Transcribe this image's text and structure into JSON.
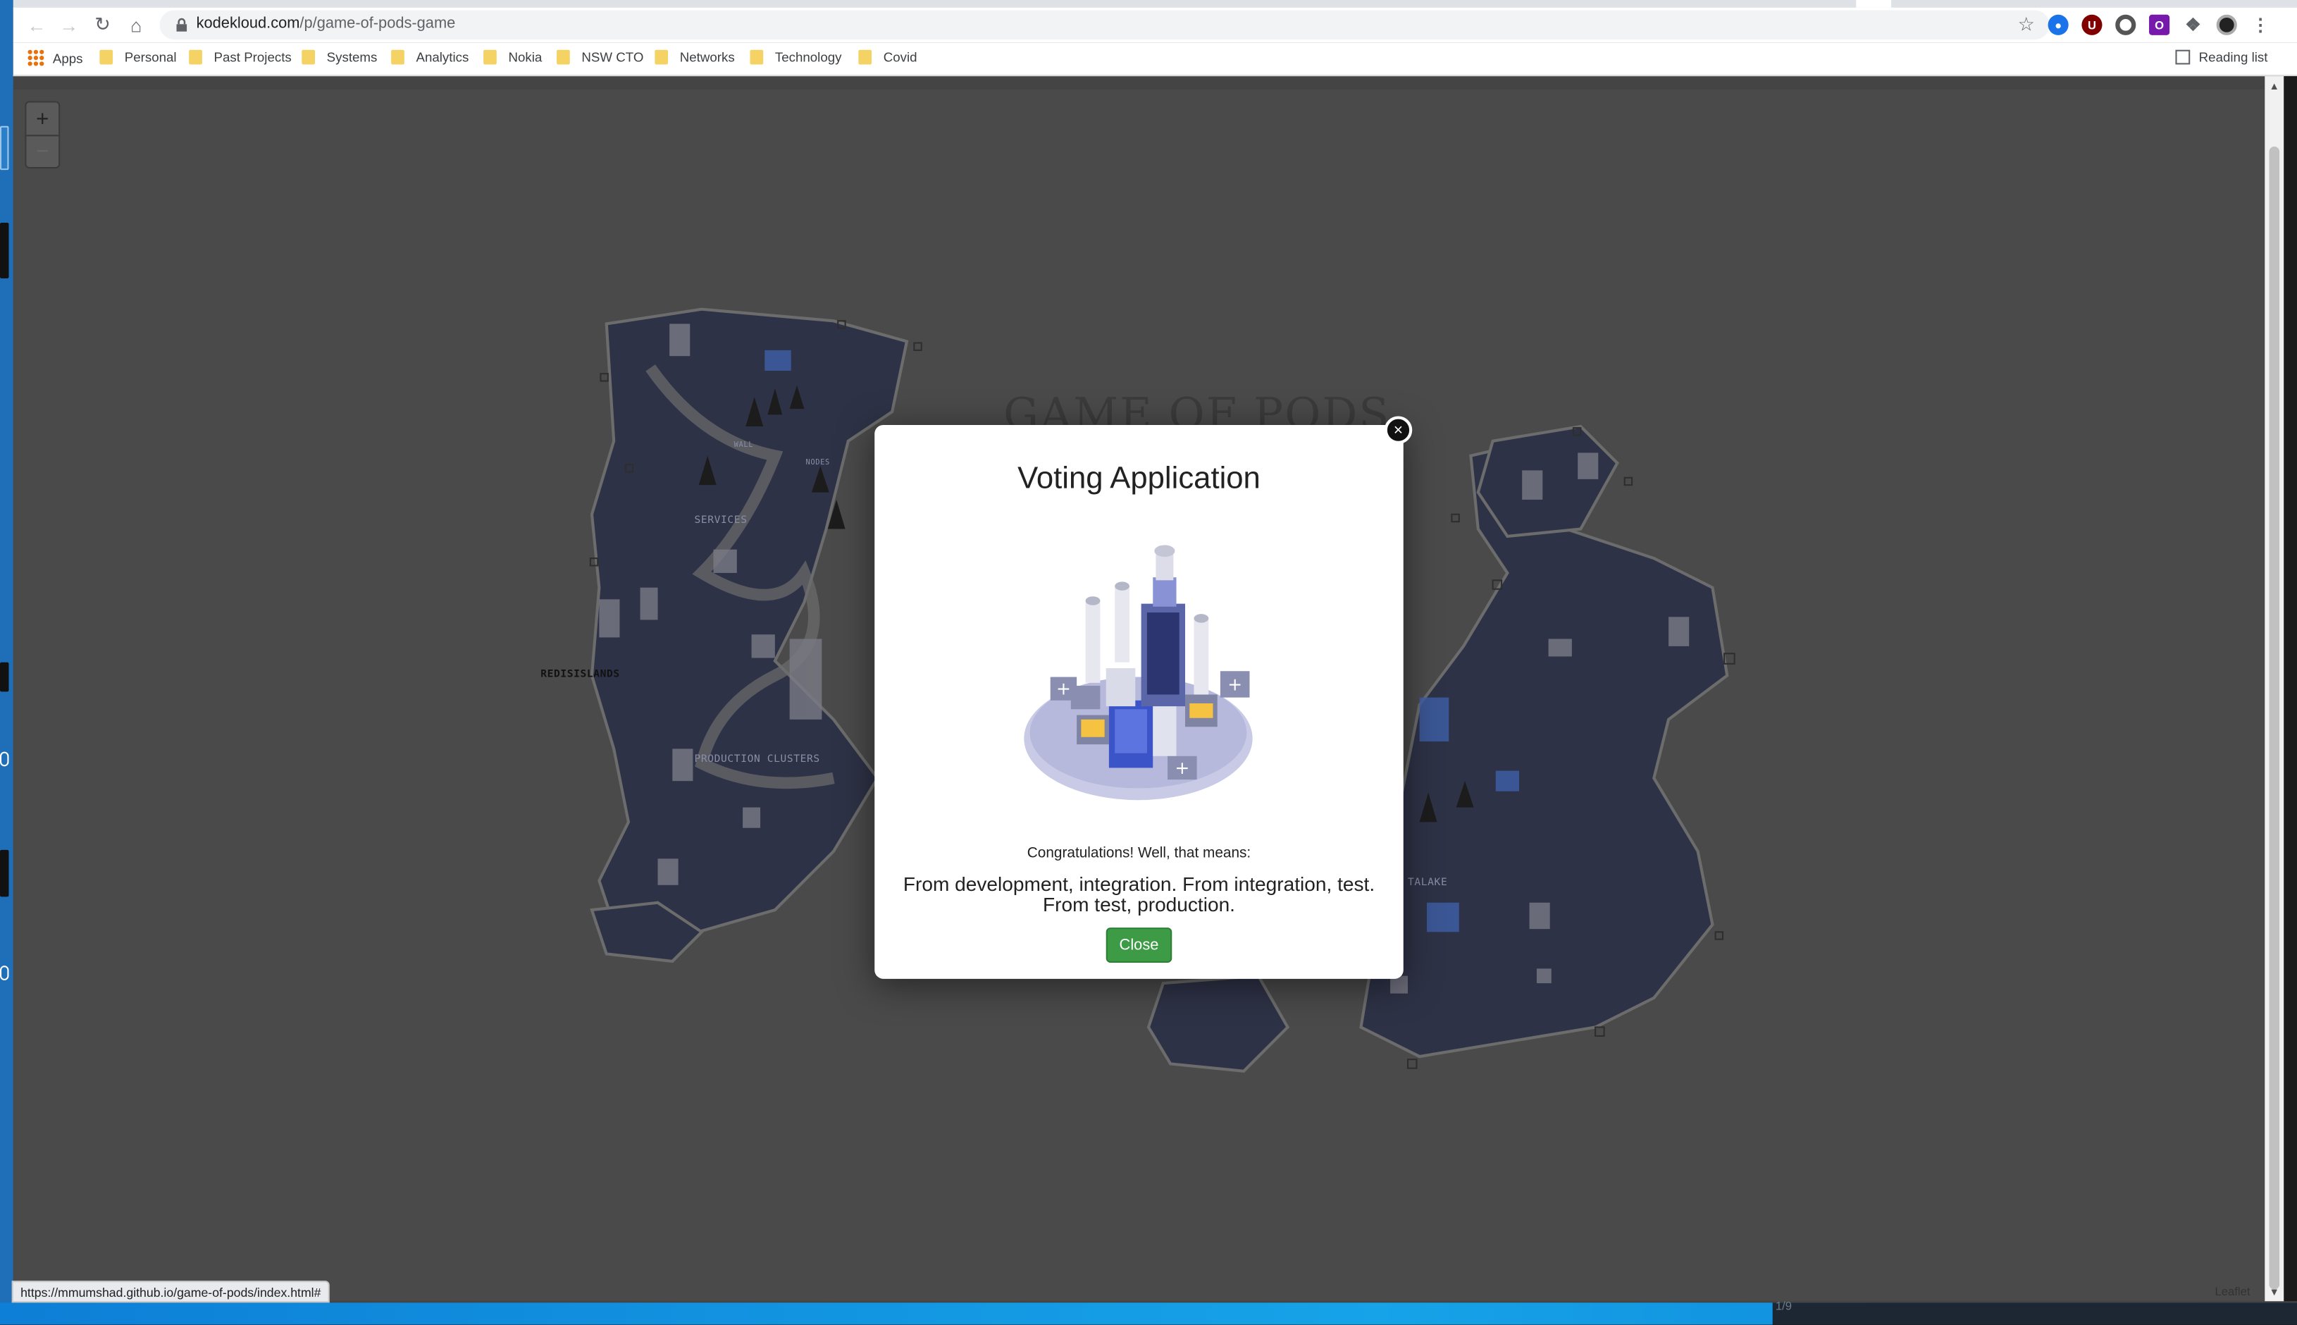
{
  "browser": {
    "url_host": "kodekloud.com",
    "url_path": "/p/game-of-pods-game",
    "bookmarks": [
      "Apps",
      "Personal",
      "Past Projects",
      "Systems",
      "Analytics",
      "Nokia",
      "NSW CTO",
      "Networks",
      "Technology",
      "Covid"
    ],
    "reading_list": "Reading list",
    "status_url": "https://mmumshad.github.io/game-of-pods/index.html#",
    "extension_u": "U",
    "extension_o": "O"
  },
  "map": {
    "zoom_in": "+",
    "zoom_out": "−",
    "logo": "GAME OF PODS",
    "labels": {
      "services": "SERVICES",
      "redis_islands": "REDISISLANDS",
      "production_clusters": "PRODUCTION CLUSTERS",
      "datalake": "TALAKE",
      "wall": "WALL",
      "network": "NODES"
    },
    "attribution": "Leaflet",
    "page_counter": "1/9"
  },
  "modal": {
    "title": "Voting Application",
    "subtitle": "Congratulations! Well, that means:",
    "message_line1": "From development, integration. From integration, test.",
    "message_line2": "From test, production.",
    "close_label": "Close",
    "close_x": "×"
  },
  "colors": {
    "accent_green": "#3d9b45",
    "map_sea": "#2e3246",
    "map_land": "#6c6c6c",
    "page_overlay": "#4a4a4a"
  }
}
